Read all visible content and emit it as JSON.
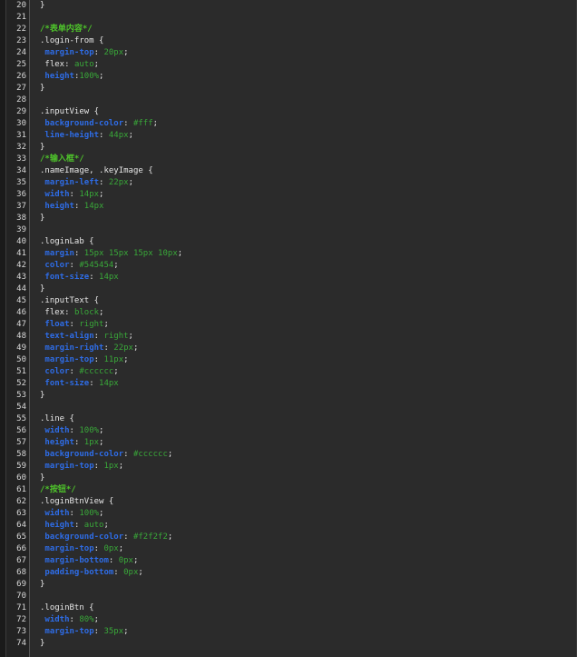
{
  "editor": {
    "lines": [
      {
        "num": "20",
        "tokens": [
          {
            "t": "}",
            "c": "punct"
          }
        ]
      },
      {
        "num": "21",
        "tokens": []
      },
      {
        "num": "22",
        "tokens": [
          {
            "t": "/*表单内容*/",
            "c": "comment"
          }
        ]
      },
      {
        "num": "23",
        "tokens": [
          {
            "t": ".login-from {",
            "c": "sel"
          }
        ]
      },
      {
        "num": "24",
        "tokens": [
          {
            "t": " "
          },
          {
            "t": "margin-top",
            "c": "prop"
          },
          {
            "t": ": "
          },
          {
            "t": "20px",
            "c": "val"
          },
          {
            "t": ";"
          }
        ]
      },
      {
        "num": "25",
        "tokens": [
          {
            "t": " flex: "
          },
          {
            "t": "auto",
            "c": "val"
          },
          {
            "t": ";"
          }
        ]
      },
      {
        "num": "26",
        "tokens": [
          {
            "t": " "
          },
          {
            "t": "height",
            "c": "prop"
          },
          {
            "t": ":"
          },
          {
            "t": "100%",
            "c": "val"
          },
          {
            "t": ";"
          }
        ]
      },
      {
        "num": "27",
        "tokens": [
          {
            "t": "}",
            "c": "punct"
          }
        ]
      },
      {
        "num": "28",
        "tokens": []
      },
      {
        "num": "29",
        "tokens": [
          {
            "t": ".inputView {",
            "c": "sel"
          }
        ]
      },
      {
        "num": "30",
        "tokens": [
          {
            "t": " "
          },
          {
            "t": "background-color",
            "c": "prop"
          },
          {
            "t": ": "
          },
          {
            "t": "#fff",
            "c": "val"
          },
          {
            "t": ";"
          }
        ]
      },
      {
        "num": "31",
        "tokens": [
          {
            "t": " "
          },
          {
            "t": "line-height",
            "c": "prop"
          },
          {
            "t": ": "
          },
          {
            "t": "44px",
            "c": "val"
          },
          {
            "t": ";"
          }
        ]
      },
      {
        "num": "32",
        "tokens": [
          {
            "t": "}",
            "c": "punct"
          }
        ]
      },
      {
        "num": "33",
        "tokens": [
          {
            "t": "/*输入框*/",
            "c": "comment"
          }
        ]
      },
      {
        "num": "34",
        "tokens": [
          {
            "t": ".nameImage, .keyImage {",
            "c": "sel"
          }
        ]
      },
      {
        "num": "35",
        "tokens": [
          {
            "t": " "
          },
          {
            "t": "margin-left",
            "c": "prop"
          },
          {
            "t": ": "
          },
          {
            "t": "22px",
            "c": "val"
          },
          {
            "t": ";"
          }
        ]
      },
      {
        "num": "36",
        "tokens": [
          {
            "t": " "
          },
          {
            "t": "width",
            "c": "prop"
          },
          {
            "t": ": "
          },
          {
            "t": "14px",
            "c": "val"
          },
          {
            "t": ";"
          }
        ]
      },
      {
        "num": "37",
        "tokens": [
          {
            "t": " "
          },
          {
            "t": "height",
            "c": "prop"
          },
          {
            "t": ": "
          },
          {
            "t": "14px",
            "c": "val"
          }
        ]
      },
      {
        "num": "38",
        "tokens": [
          {
            "t": "}",
            "c": "punct"
          }
        ]
      },
      {
        "num": "39",
        "tokens": []
      },
      {
        "num": "40",
        "tokens": [
          {
            "t": ".loginLab {",
            "c": "sel"
          }
        ]
      },
      {
        "num": "41",
        "tokens": [
          {
            "t": " "
          },
          {
            "t": "margin",
            "c": "prop"
          },
          {
            "t": ": "
          },
          {
            "t": "15px 15px 15px 10px",
            "c": "val"
          },
          {
            "t": ";"
          }
        ]
      },
      {
        "num": "42",
        "tokens": [
          {
            "t": " "
          },
          {
            "t": "color",
            "c": "prop"
          },
          {
            "t": ": "
          },
          {
            "t": "#545454",
            "c": "val"
          },
          {
            "t": ";"
          }
        ]
      },
      {
        "num": "43",
        "tokens": [
          {
            "t": " "
          },
          {
            "t": "font-size",
            "c": "prop"
          },
          {
            "t": ": "
          },
          {
            "t": "14px",
            "c": "val"
          }
        ]
      },
      {
        "num": "44",
        "tokens": [
          {
            "t": "}",
            "c": "punct"
          }
        ]
      },
      {
        "num": "45",
        "tokens": [
          {
            "t": ".inputText {",
            "c": "sel"
          }
        ]
      },
      {
        "num": "46",
        "tokens": [
          {
            "t": " flex: "
          },
          {
            "t": "block",
            "c": "val"
          },
          {
            "t": ";"
          }
        ]
      },
      {
        "num": "47",
        "tokens": [
          {
            "t": " "
          },
          {
            "t": "float",
            "c": "prop"
          },
          {
            "t": ": "
          },
          {
            "t": "right",
            "c": "val"
          },
          {
            "t": ";"
          }
        ]
      },
      {
        "num": "48",
        "tokens": [
          {
            "t": " "
          },
          {
            "t": "text-align",
            "c": "prop"
          },
          {
            "t": ": "
          },
          {
            "t": "right",
            "c": "val"
          },
          {
            "t": ";"
          }
        ]
      },
      {
        "num": "49",
        "tokens": [
          {
            "t": " "
          },
          {
            "t": "margin-right",
            "c": "prop"
          },
          {
            "t": ": "
          },
          {
            "t": "22px",
            "c": "val"
          },
          {
            "t": ";"
          }
        ]
      },
      {
        "num": "50",
        "tokens": [
          {
            "t": " "
          },
          {
            "t": "margin-top",
            "c": "prop"
          },
          {
            "t": ": "
          },
          {
            "t": "11px",
            "c": "val"
          },
          {
            "t": ";"
          }
        ]
      },
      {
        "num": "51",
        "tokens": [
          {
            "t": " "
          },
          {
            "t": "color",
            "c": "prop"
          },
          {
            "t": ": "
          },
          {
            "t": "#cccccc",
            "c": "val"
          },
          {
            "t": ";"
          }
        ]
      },
      {
        "num": "52",
        "tokens": [
          {
            "t": " "
          },
          {
            "t": "font-size",
            "c": "prop"
          },
          {
            "t": ": "
          },
          {
            "t": "14px",
            "c": "val"
          }
        ]
      },
      {
        "num": "53",
        "tokens": [
          {
            "t": "}",
            "c": "punct"
          }
        ]
      },
      {
        "num": "54",
        "tokens": []
      },
      {
        "num": "55",
        "tokens": [
          {
            "t": ".line {",
            "c": "sel"
          }
        ]
      },
      {
        "num": "56",
        "tokens": [
          {
            "t": " "
          },
          {
            "t": "width",
            "c": "prop"
          },
          {
            "t": ": "
          },
          {
            "t": "100%",
            "c": "val"
          },
          {
            "t": ";"
          }
        ]
      },
      {
        "num": "57",
        "tokens": [
          {
            "t": " "
          },
          {
            "t": "height",
            "c": "prop"
          },
          {
            "t": ": "
          },
          {
            "t": "1px",
            "c": "val"
          },
          {
            "t": ";"
          }
        ]
      },
      {
        "num": "58",
        "tokens": [
          {
            "t": " "
          },
          {
            "t": "background-color",
            "c": "prop"
          },
          {
            "t": ": "
          },
          {
            "t": "#cccccc",
            "c": "val"
          },
          {
            "t": ";"
          }
        ]
      },
      {
        "num": "59",
        "tokens": [
          {
            "t": " "
          },
          {
            "t": "margin-top",
            "c": "prop"
          },
          {
            "t": ": "
          },
          {
            "t": "1px",
            "c": "val"
          },
          {
            "t": ";"
          }
        ]
      },
      {
        "num": "60",
        "tokens": [
          {
            "t": "}",
            "c": "punct"
          }
        ]
      },
      {
        "num": "61",
        "tokens": [
          {
            "t": "/*按钮*/",
            "c": "comment"
          }
        ]
      },
      {
        "num": "62",
        "tokens": [
          {
            "t": ".loginBtnView {",
            "c": "sel"
          }
        ]
      },
      {
        "num": "63",
        "tokens": [
          {
            "t": " "
          },
          {
            "t": "width",
            "c": "prop"
          },
          {
            "t": ": "
          },
          {
            "t": "100%",
            "c": "val"
          },
          {
            "t": ";"
          }
        ]
      },
      {
        "num": "64",
        "tokens": [
          {
            "t": " "
          },
          {
            "t": "height",
            "c": "prop"
          },
          {
            "t": ": "
          },
          {
            "t": "auto",
            "c": "val"
          },
          {
            "t": ";"
          }
        ]
      },
      {
        "num": "65",
        "tokens": [
          {
            "t": " "
          },
          {
            "t": "background-color",
            "c": "prop"
          },
          {
            "t": ": "
          },
          {
            "t": "#f2f2f2",
            "c": "val"
          },
          {
            "t": ";"
          }
        ]
      },
      {
        "num": "66",
        "tokens": [
          {
            "t": " "
          },
          {
            "t": "margin-top",
            "c": "prop"
          },
          {
            "t": ": "
          },
          {
            "t": "0px",
            "c": "val"
          },
          {
            "t": ";"
          }
        ]
      },
      {
        "num": "67",
        "tokens": [
          {
            "t": " "
          },
          {
            "t": "margin-bottom",
            "c": "prop"
          },
          {
            "t": ": "
          },
          {
            "t": "0px",
            "c": "val"
          },
          {
            "t": ";"
          }
        ]
      },
      {
        "num": "68",
        "tokens": [
          {
            "t": " "
          },
          {
            "t": "padding-bottom",
            "c": "prop"
          },
          {
            "t": ": "
          },
          {
            "t": "0px",
            "c": "val"
          },
          {
            "t": ";"
          }
        ]
      },
      {
        "num": "69",
        "tokens": [
          {
            "t": "}",
            "c": "punct"
          }
        ]
      },
      {
        "num": "70",
        "tokens": []
      },
      {
        "num": "71",
        "tokens": [
          {
            "t": ".loginBtn {",
            "c": "sel"
          }
        ]
      },
      {
        "num": "72",
        "tokens": [
          {
            "t": " "
          },
          {
            "t": "width",
            "c": "prop"
          },
          {
            "t": ": "
          },
          {
            "t": "80%",
            "c": "val"
          },
          {
            "t": ";"
          }
        ]
      },
      {
        "num": "73",
        "tokens": [
          {
            "t": " "
          },
          {
            "t": "margin-top",
            "c": "prop"
          },
          {
            "t": ": "
          },
          {
            "t": "35px",
            "c": "val"
          },
          {
            "t": ";"
          }
        ]
      },
      {
        "num": "74",
        "tokens": [
          {
            "t": "}",
            "c": "punct"
          }
        ]
      }
    ]
  },
  "colors": {
    "background": "#2b2b2b",
    "gutter": "#232323",
    "comment": "#4ec32b",
    "property": "#2e6ce6",
    "value": "#39a839",
    "text": "#e6e6e6"
  }
}
